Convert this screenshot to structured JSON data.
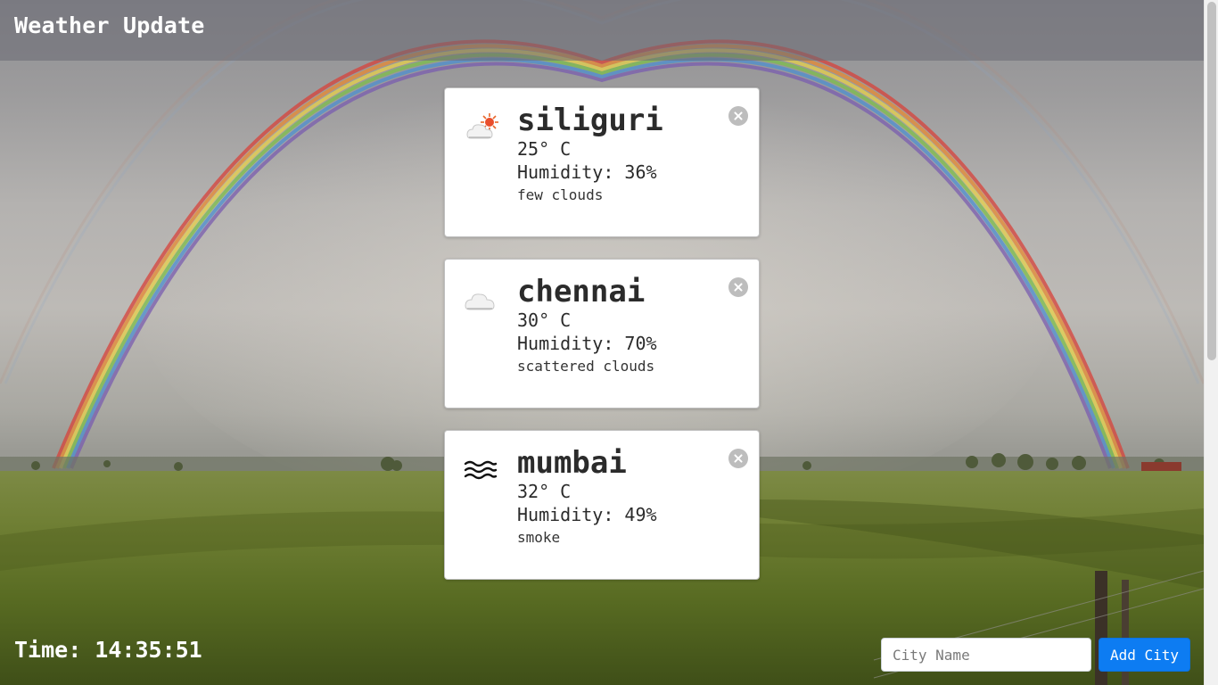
{
  "header": {
    "title": "Weather Update"
  },
  "cards": [
    {
      "city": "siliguri",
      "temperature": "25° C",
      "humidity": "Humidity: 36%",
      "description": "few clouds",
      "icon": "few-clouds-icon"
    },
    {
      "city": "chennai",
      "temperature": "30° C",
      "humidity": "Humidity: 70%",
      "description": "scattered clouds",
      "icon": "cloud-icon"
    },
    {
      "city": "mumbai",
      "temperature": "32° C",
      "humidity": "Humidity: 49%",
      "description": "smoke",
      "icon": "haze-icon"
    }
  ],
  "footer": {
    "time": "Time: 14:35:51",
    "city_input_placeholder": "City Name",
    "add_button_label": "Add City"
  },
  "colors": {
    "accent": "#0d7cf2",
    "close": "#bdbdbd"
  }
}
